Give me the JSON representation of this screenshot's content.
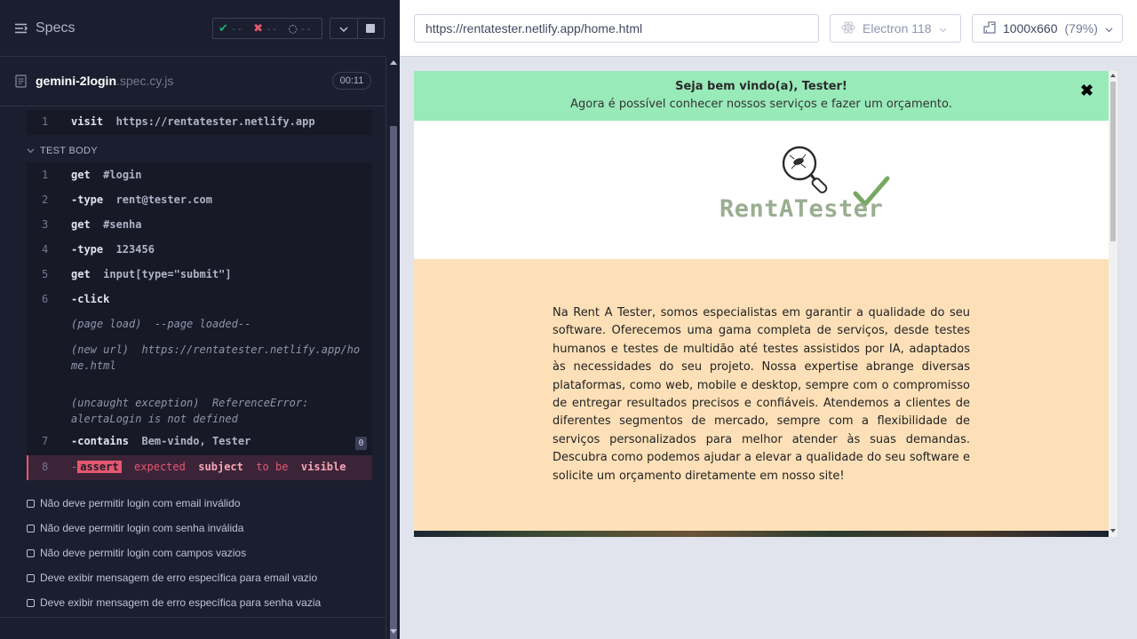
{
  "reporter": {
    "specs_label": "Specs",
    "stats": {
      "passed": "--",
      "failed": "--",
      "pending": "--"
    },
    "spec": {
      "name": "gemini-2login",
      "ext": ".spec.cy.js",
      "duration": "00:11"
    },
    "before_cmds": [
      {
        "num": "1",
        "name": "visit",
        "message": "https://rentatester.netlify.app"
      }
    ],
    "test_body_label": "TEST BODY",
    "commands": [
      {
        "num": "1",
        "name": "get",
        "message": "#login"
      },
      {
        "num": "2",
        "name": "-type",
        "message": "rent@tester.com"
      },
      {
        "num": "3",
        "name": "get",
        "message": "#senha"
      },
      {
        "num": "4",
        "name": "-type",
        "message": "123456"
      },
      {
        "num": "5",
        "name": "get",
        "message": "input[type=\"submit\"]"
      },
      {
        "num": "6",
        "name": "-click",
        "message": ""
      }
    ],
    "events": [
      {
        "name": "(page load)",
        "message": "--page loaded--"
      },
      {
        "name": "(new url)",
        "message": "https://rentatester.netlify.app/home.html"
      },
      {
        "name": "(uncaught exception)",
        "message": "ReferenceError: alertaLogin is not defined"
      }
    ],
    "contains_cmd": {
      "num": "7",
      "name": "-contains",
      "message": "Bem-vindo, Tester",
      "count": "0"
    },
    "failed_cmd": {
      "num": "8",
      "prefix": "-",
      "name": "assert",
      "w1": "expected",
      "w2": "subject",
      "w3": "to be",
      "w4": "visible"
    },
    "tests": [
      "Não deve permitir login com email inválido",
      "Não deve permitir login com senha inválida",
      "Não deve permitir login com campos vazios",
      "Deve exibir mensagem de erro específica para email vazio",
      "Deve exibir mensagem de erro específica para senha vazia"
    ]
  },
  "aut": {
    "url": "https://rentatester.netlify.app/home.html",
    "browser": "Electron 118",
    "viewport": "1000x660",
    "scale": "(79%)",
    "page": {
      "welcome_title": "Seja bem vindo(a), Tester!",
      "welcome_sub": "Agora é possível conhecer nossos serviços e fazer um orçamento.",
      "close_symbol": "✖",
      "logo_text": "RentATester",
      "about": "Na Rent A Tester, somos especialistas em garantir a qualidade do seu software. Oferecemos uma gama completa de serviços, desde testes humanos e testes de multidão até testes assistidos por IA, adaptados às necessidades do seu projeto. Nossa expertise abrange diversas plataformas, como web, mobile e desktop, sempre com o compromisso de entregar resultados precisos e confiáveis. Atendemos a clientes de diferentes segmentos de mercado, sempre com a flexibilidade de serviços personalizados para melhor atender às suas demandas. Descubra como podemos ajudar a elevar a qualidade do seu software e solicite um orçamento diretamente em nosso site!"
    }
  },
  "colors": {
    "pass": "#1fa971",
    "fail": "#e45770",
    "welcome_bg": "#98eab9",
    "about_bg": "#fde0b8",
    "logo": "#9aae91"
  }
}
